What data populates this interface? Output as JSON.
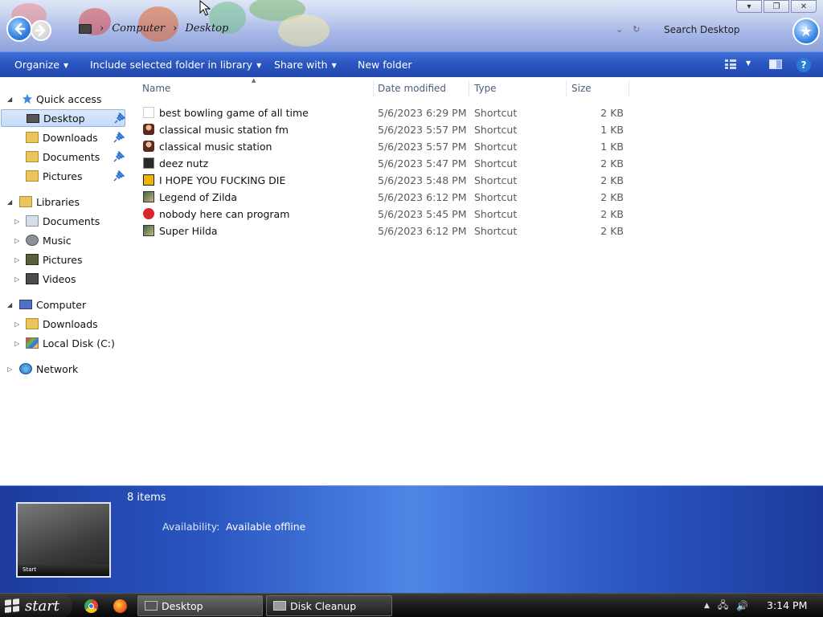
{
  "window": {
    "breadcrumb": [
      "Computer",
      "Desktop"
    ],
    "search_placeholder": "Search Desktop"
  },
  "toolbar": {
    "organize": "Organize",
    "include_library": "Include selected folder in library",
    "share_with": "Share with",
    "new_folder": "New folder"
  },
  "sidebar": {
    "quick_access": "Quick access",
    "quick_items": [
      "Desktop",
      "Downloads",
      "Documents",
      "Pictures"
    ],
    "libraries": "Libraries",
    "library_items": [
      "Documents",
      "Music",
      "Pictures",
      "Videos"
    ],
    "computer": "Computer",
    "computer_items": [
      "Downloads",
      "Local Disk (C:)"
    ],
    "network": "Network"
  },
  "columns": {
    "name": "Name",
    "date": "Date modified",
    "type": "Type",
    "size": "Size"
  },
  "files": [
    {
      "name": "best bowling game of all time",
      "date": "5/6/2023 6:29 PM",
      "type": "Shortcut",
      "size": "2 KB",
      "icon": "bowling-icon"
    },
    {
      "name": "classical music station fm",
      "date": "5/6/2023 5:57 PM",
      "type": "Shortcut",
      "size": "1 KB",
      "icon": "portrait-icon"
    },
    {
      "name": "classical music station",
      "date": "5/6/2023 5:57 PM",
      "type": "Shortcut",
      "size": "1 KB",
      "icon": "portrait-icon"
    },
    {
      "name": "deez nutz",
      "date": "5/6/2023 5:47 PM",
      "type": "Shortcut",
      "size": "2 KB",
      "icon": "shortcut-icon"
    },
    {
      "name": "I HOPE YOU FUCKING DIE",
      "date": "5/6/2023 5:48 PM",
      "type": "Shortcut",
      "size": "2 KB",
      "icon": "app-icon"
    },
    {
      "name": "Legend of Zilda",
      "date": "5/6/2023 6:12 PM",
      "type": "Shortcut",
      "size": "2 KB",
      "icon": "game-icon"
    },
    {
      "name": "nobody here can program",
      "date": "5/6/2023 5:45 PM",
      "type": "Shortcut",
      "size": "2 KB",
      "icon": "dev-icon"
    },
    {
      "name": "Super Hilda",
      "date": "5/6/2023 6:12 PM",
      "type": "Shortcut",
      "size": "2 KB",
      "icon": "game-icon"
    }
  ],
  "details": {
    "item_count": "8 items",
    "availability_label": "Availability:",
    "availability_value": "Available offline",
    "thumb_start": "Start"
  },
  "taskbar": {
    "start_label": "start",
    "tasks": [
      "Desktop",
      "Disk Cleanup"
    ],
    "clock": "3:14 PM"
  },
  "colors": {
    "command_bar": "#2a54bf",
    "details_pane": "#2a55c0",
    "selection": "#c6dbf7"
  }
}
